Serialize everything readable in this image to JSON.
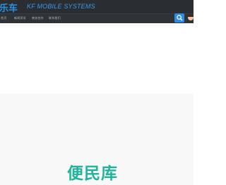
{
  "header": {
    "logo_text": "乐车",
    "tagline": "KF MOBILE SYSTEMS"
  },
  "nav": {
    "items": [
      {
        "label": "首页"
      },
      {
        "label": "新闻资讯"
      },
      {
        "label": "商务合作"
      },
      {
        "label": "联系我们"
      }
    ]
  },
  "search": {
    "icon": "search-icon"
  },
  "hero": {
    "title": "便民库"
  },
  "colors": {
    "header_bg": "#2a2d31",
    "nav_bg": "#2f3237",
    "accent": "#2d8be6",
    "hero_title": "#1fb59a"
  }
}
